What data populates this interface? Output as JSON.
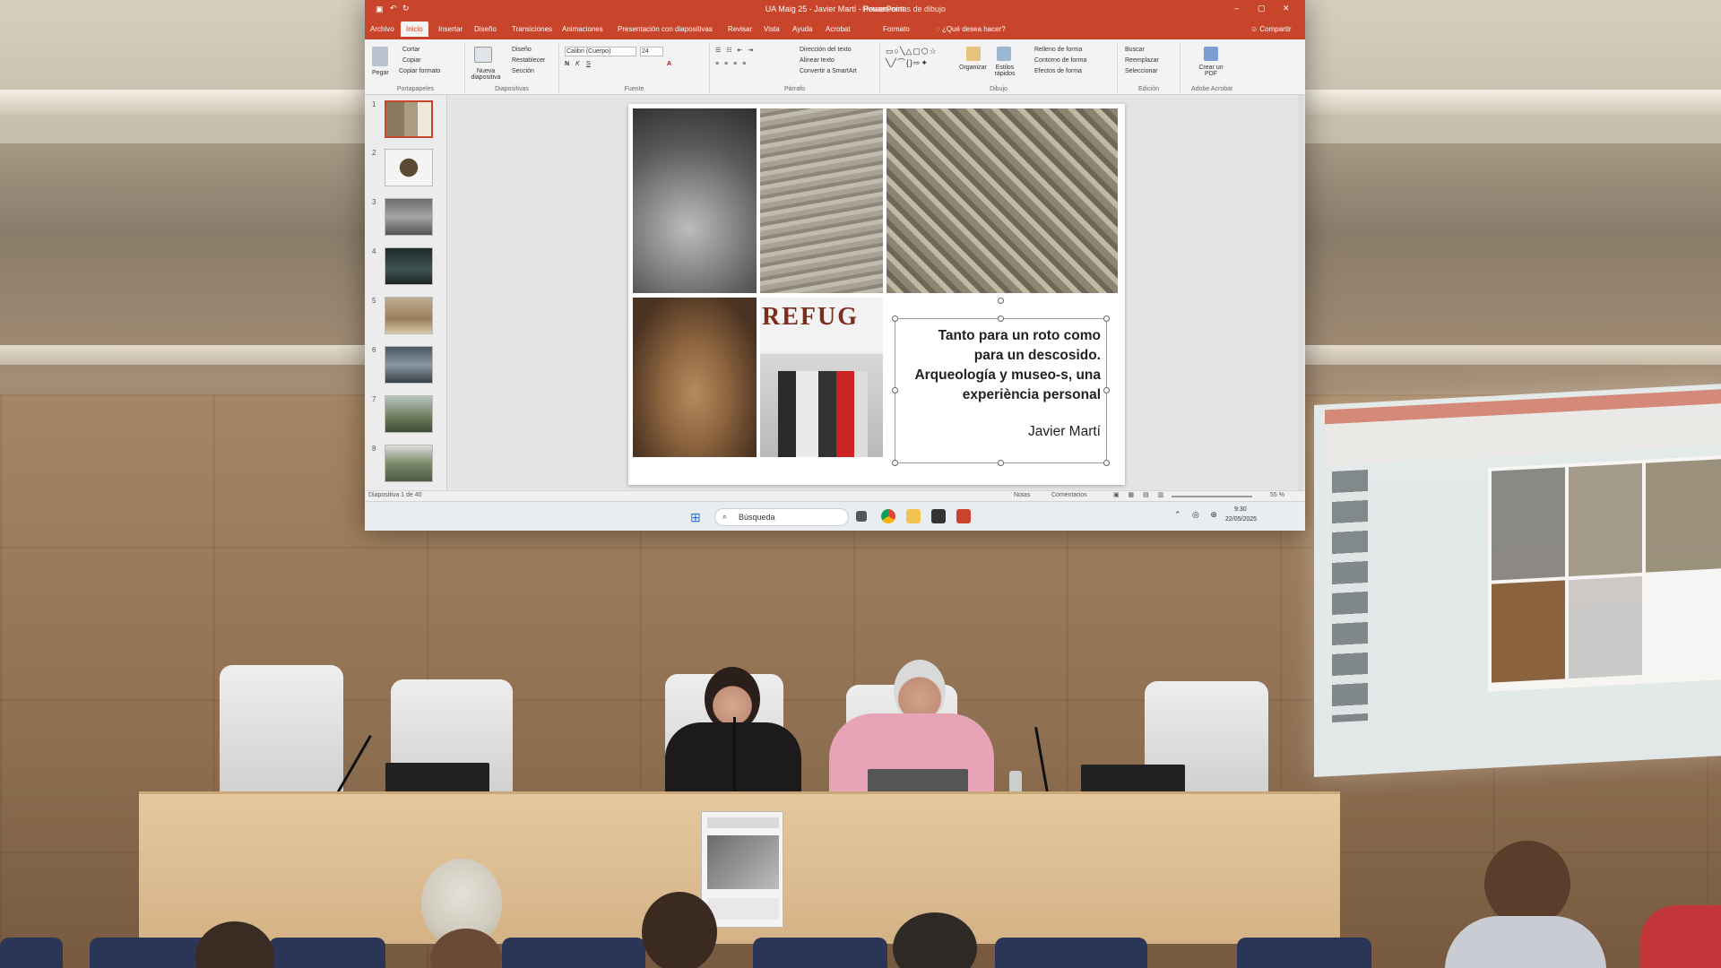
{
  "powerpoint": {
    "window_title": "UA Maig 25 - Javier Martí  -  PowerPoint",
    "context_title": "Herramientas de dibujo",
    "tabs": [
      "Archivo",
      "Inicio",
      "Insertar",
      "Diseño",
      "Transiciones",
      "Animaciones",
      "Presentación con diapositivas",
      "Revisar",
      "Vista",
      "Ayuda",
      "Acrobat",
      "Formato"
    ],
    "tell_me": "¿Qué desea hacer?",
    "share": "Compartir",
    "ribbon": {
      "groups": [
        "Portapapeles",
        "Diapositivas",
        "Fuente",
        "Párrafo",
        "Dibujo",
        "Edición",
        "Adobe Acrobat"
      ],
      "paste": "Pegar",
      "cut": "Cortar",
      "copy": "Copiar",
      "copy_format": "Copiar formato",
      "new_slide": "Nueva diapositiva",
      "layout": "Diseño",
      "reset": "Restablecer",
      "section": "Sección",
      "font_name": "Calibri (Cuerpo)",
      "font_size": "24",
      "text_direction": "Dirección del texto",
      "align_text": "Alinear texto",
      "smartart": "Convertir a SmartArt",
      "arrange": "Organizar",
      "quick_styles": "Estilos rápidos",
      "shape_fill": "Relleno de forma",
      "shape_outline": "Contorno de forma",
      "shape_effects": "Efectos de forma",
      "find": "Buscar",
      "replace": "Reemplazar",
      "select": "Seleccionar",
      "create_pdf": "Crear un PDF"
    },
    "thumbnails": [
      "1",
      "2",
      "3",
      "4",
      "5",
      "6",
      "7",
      "8"
    ],
    "slide": {
      "title_lines": [
        "Tanto para un roto como",
        "para un descosido.",
        "Arqueología y museo-s, una",
        "experiència personal"
      ],
      "author": "Javier Martí",
      "photo_text": "REFUG"
    },
    "status": {
      "slide_counter": "Diapositiva 1 de 40",
      "notes": "Notas",
      "comments": "Comentarios",
      "zoom": "55 %"
    },
    "taskbar": {
      "search": "Búsqueda",
      "time": "9:30",
      "date": "22/05/2025"
    }
  }
}
